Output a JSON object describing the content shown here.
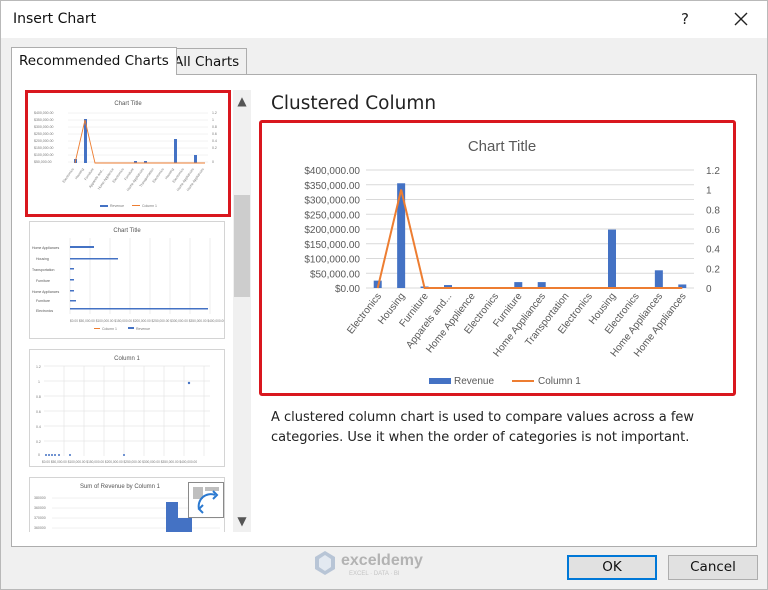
{
  "dialog": {
    "title": "Insert Chart",
    "help": "?"
  },
  "tabs": [
    {
      "label": "Recommended Charts",
      "active": true
    },
    {
      "label": "All Charts",
      "active": false
    }
  ],
  "chart_type_title": "Clustered Column",
  "description": "A clustered column chart is used to compare values across a few categories. Use it when the order of categories is not important.",
  "buttons": {
    "ok": "OK",
    "cancel": "Cancel"
  },
  "watermark": {
    "brand": "exceldemy",
    "tagline": "EXCEL · DATA · BI"
  },
  "thumbnails": [
    {
      "title": "Chart Title",
      "selected": true
    },
    {
      "title": "Chart Title",
      "selected": false
    },
    {
      "title": "Column 1",
      "selected": false
    },
    {
      "title": "Sum of Revenue by Column 1",
      "selected": false
    }
  ],
  "colors": {
    "revenue": "#4472c4",
    "column1": "#ed7d31",
    "selection": "#d9171e",
    "accent": "#0078d7"
  },
  "chart_data": {
    "type": "bar",
    "title": "Chart Title",
    "categories": [
      "Electronics",
      "Housing",
      "Furniture",
      "Apparels and...",
      "Home Applience",
      "Electronics",
      "Furniture",
      "Home Appliances",
      "Transportation",
      "Electronics",
      "Housing",
      "Electronics",
      "Home Appliances",
      "Home Appliances"
    ],
    "series": [
      {
        "name": "Revenue",
        "kind": "bar",
        "axis": "primary",
        "values": [
          25000,
          355000,
          5000,
          10000,
          0,
          3000,
          20000,
          20000,
          0,
          0,
          198000,
          0,
          60000,
          12000
        ]
      },
      {
        "name": "Column 1",
        "kind": "line",
        "axis": "secondary",
        "values": [
          0,
          1,
          0,
          0,
          0,
          0,
          0,
          0,
          0,
          0,
          0,
          0,
          0,
          0
        ]
      }
    ],
    "y_ticks": [
      "$400,000.00",
      "$350,000.00",
      "$300,000.00",
      "$250,000.00",
      "$200,000.00",
      "$150,000.00",
      "$100,000.00",
      "$50,000.00",
      "$0.00"
    ],
    "y2_ticks": [
      "1.2",
      "1",
      "0.8",
      "0.6",
      "0.4",
      "0.2",
      "0"
    ],
    "ylim": [
      0,
      400000
    ],
    "y2lim": [
      0,
      1.2
    ],
    "legend_position": "bottom"
  }
}
